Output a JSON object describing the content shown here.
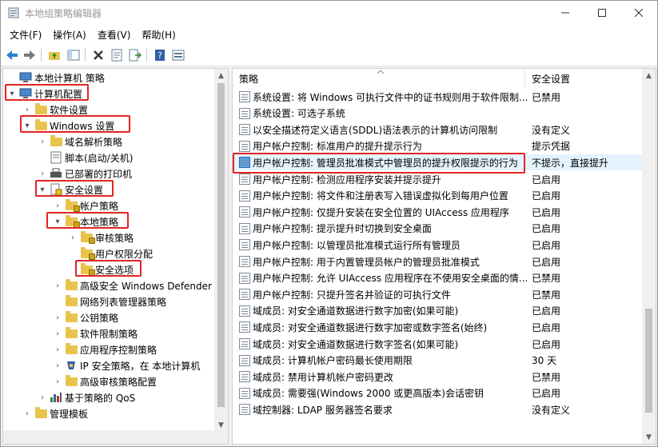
{
  "window": {
    "title": "本地组策略编辑器"
  },
  "menu": [
    {
      "id": "file",
      "label": "文件(F)"
    },
    {
      "id": "action",
      "label": "操作(A)"
    },
    {
      "id": "view",
      "label": "查看(V)"
    },
    {
      "id": "help",
      "label": "帮助(H)"
    }
  ],
  "tree": [
    {
      "label": "本地计算机 策略",
      "depth": 0,
      "expander": "",
      "icon": "computer-policy-icon"
    },
    {
      "label": "计算机配置",
      "depth": 0,
      "expander": "▾",
      "icon": "computer-icon"
    },
    {
      "label": "软件设置",
      "depth": 1,
      "expander": "›",
      "icon": "folder-icon"
    },
    {
      "label": "Windows 设置",
      "depth": 1,
      "expander": "▾",
      "icon": "folder-icon"
    },
    {
      "label": "域名解析策略",
      "depth": 2,
      "expander": "›",
      "icon": "folder-icon"
    },
    {
      "label": "脚本(启动/关机)",
      "depth": 2,
      "expander": "",
      "icon": "script-icon"
    },
    {
      "label": "已部署的打印机",
      "depth": 2,
      "expander": "›",
      "icon": "printer-icon"
    },
    {
      "label": "安全设置",
      "depth": 2,
      "expander": "▾",
      "icon": "security-icon"
    },
    {
      "label": "帐户策略",
      "depth": 3,
      "expander": "›",
      "icon": "folder-lock-icon"
    },
    {
      "label": "本地策略",
      "depth": 3,
      "expander": "▾",
      "icon": "folder-lock-icon"
    },
    {
      "label": "审核策略",
      "depth": 4,
      "expander": "›",
      "icon": "folder-lock-icon"
    },
    {
      "label": "用户权限分配",
      "depth": 4,
      "expander": "",
      "icon": "folder-lock-icon"
    },
    {
      "label": "安全选项",
      "depth": 4,
      "expander": "",
      "icon": "folder-lock-icon"
    },
    {
      "label": "高级安全 Windows Defender",
      "depth": 3,
      "expander": "›",
      "icon": "folder-icon"
    },
    {
      "label": "网络列表管理器策略",
      "depth": 3,
      "expander": "",
      "icon": "folder-icon"
    },
    {
      "label": "公钥策略",
      "depth": 3,
      "expander": "›",
      "icon": "folder-icon"
    },
    {
      "label": "软件限制策略",
      "depth": 3,
      "expander": "›",
      "icon": "folder-icon"
    },
    {
      "label": "应用程序控制策略",
      "depth": 3,
      "expander": "›",
      "icon": "folder-icon"
    },
    {
      "label": "IP 安全策略，在 本地计算机",
      "depth": 3,
      "expander": "›",
      "icon": "ipsec-icon"
    },
    {
      "label": "高级审核策略配置",
      "depth": 3,
      "expander": "›",
      "icon": "folder-icon"
    },
    {
      "label": "基于策略的 QoS",
      "depth": 2,
      "expander": "›",
      "icon": "chart-icon"
    },
    {
      "label": "管理模板",
      "depth": 1,
      "expander": "›",
      "icon": "folder-icon"
    }
  ],
  "list": {
    "col_policy": "策略",
    "col_setting": "安全设置",
    "rows": [
      {
        "name": "系统设置: 将 Windows 可执行文件中的证书规则用于软件限制...",
        "value": "已禁用"
      },
      {
        "name": "系统设置: 可选子系统",
        "value": ""
      },
      {
        "name": "以安全描述符定义语言(SDDL)语法表示的计算机访问限制",
        "value": "没有定义"
      },
      {
        "name": "用户帐户控制: 标准用户的提升提示行为",
        "value": "提示凭据"
      },
      {
        "name": "用户帐户控制: 管理员批准模式中管理员的提升权限提示的行为",
        "value": "不提示，直接提升"
      },
      {
        "name": "用户帐户控制: 检测应用程序安装并提示提升",
        "value": "已启用"
      },
      {
        "name": "用户帐户控制: 将文件和注册表写入错误虚拟化到每用户位置",
        "value": "已启用"
      },
      {
        "name": "用户帐户控制: 仅提升安装在安全位置的 UIAccess 应用程序",
        "value": "已启用"
      },
      {
        "name": "用户帐户控制: 提示提升时切换到安全桌面",
        "value": "已启用"
      },
      {
        "name": "用户帐户控制: 以管理员批准模式运行所有管理员",
        "value": "已启用"
      },
      {
        "name": "用户帐户控制: 用于内置管理员帐户的管理员批准模式",
        "value": "已启用"
      },
      {
        "name": "用户帐户控制: 允许 UIAccess 应用程序在不使用安全桌面的情...",
        "value": "已禁用"
      },
      {
        "name": "用户帐户控制: 只提升签名并验证的可执行文件",
        "value": "已禁用"
      },
      {
        "name": "域成员: 对安全通道数据进行数字加密(如果可能)",
        "value": "已启用"
      },
      {
        "name": "域成员: 对安全通道数据进行数字加密或数字签名(始终)",
        "value": "已启用"
      },
      {
        "name": "域成员: 对安全通道数据进行数字签名(如果可能)",
        "value": "已启用"
      },
      {
        "name": "域成员: 计算机帐户密码最长使用期限",
        "value": "30 天"
      },
      {
        "name": "域成员: 禁用计算机帐户密码更改",
        "value": "已禁用"
      },
      {
        "name": "域成员: 需要强(Windows 2000 或更高版本)会话密钥",
        "value": "已启用"
      },
      {
        "name": "域控制器: LDAP 服务器签名要求",
        "value": "没有定义"
      }
    ]
  },
  "colors": {
    "highlight": "#e02424",
    "selected_row": "#e5f3ff",
    "folder": "#e8c44f"
  }
}
